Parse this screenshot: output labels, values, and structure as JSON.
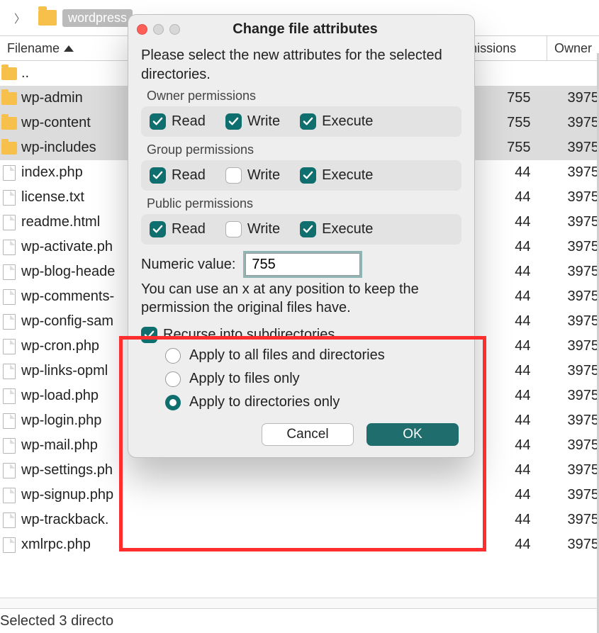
{
  "breadcrumb": {
    "folder_label": "wordpress"
  },
  "headers": {
    "filename": "Filename",
    "permissions": "rmissions",
    "owner": "Owner"
  },
  "files": [
    {
      "name": "..",
      "type": "folder",
      "sel": false,
      "perm": "",
      "own": ""
    },
    {
      "name": "wp-admin",
      "type": "folder",
      "sel": true,
      "perm": "755",
      "own": "3975"
    },
    {
      "name": "wp-content",
      "type": "folder",
      "sel": true,
      "perm": "755",
      "own": "3975"
    },
    {
      "name": "wp-includes",
      "type": "folder",
      "sel": true,
      "perm": "755",
      "own": "3975"
    },
    {
      "name": "index.php",
      "type": "file",
      "sel": false,
      "perm": "44",
      "own": "3975"
    },
    {
      "name": "license.txt",
      "type": "file",
      "sel": false,
      "perm": "44",
      "own": "3975"
    },
    {
      "name": "readme.html",
      "type": "file",
      "sel": false,
      "perm": "44",
      "own": "3975"
    },
    {
      "name": "wp-activate.ph",
      "type": "file",
      "sel": false,
      "perm": "44",
      "own": "3975"
    },
    {
      "name": "wp-blog-heade",
      "type": "file",
      "sel": false,
      "perm": "44",
      "own": "3975"
    },
    {
      "name": "wp-comments-",
      "type": "file",
      "sel": false,
      "perm": "44",
      "own": "3975"
    },
    {
      "name": "wp-config-sam",
      "type": "file",
      "sel": false,
      "perm": "44",
      "own": "3975"
    },
    {
      "name": "wp-cron.php",
      "type": "file",
      "sel": false,
      "perm": "44",
      "own": "3975"
    },
    {
      "name": "wp-links-opml",
      "type": "file",
      "sel": false,
      "perm": "44",
      "own": "3975"
    },
    {
      "name": "wp-load.php",
      "type": "file",
      "sel": false,
      "perm": "44",
      "own": "3975"
    },
    {
      "name": "wp-login.php",
      "type": "file",
      "sel": false,
      "perm": "44",
      "own": "3975"
    },
    {
      "name": "wp-mail.php",
      "type": "file",
      "sel": false,
      "perm": "44",
      "own": "3975"
    },
    {
      "name": "wp-settings.ph",
      "type": "file",
      "sel": false,
      "perm": "44",
      "own": "3975"
    },
    {
      "name": "wp-signup.php",
      "type": "file",
      "sel": false,
      "perm": "44",
      "own": "3975"
    },
    {
      "name": "wp-trackback.",
      "type": "file",
      "sel": false,
      "perm": "44",
      "own": "3975"
    },
    {
      "name": "xmlrpc.php",
      "type": "file",
      "sel": false,
      "perm": "44",
      "own": "3975"
    }
  ],
  "status_text": "Selected 3 directo",
  "dialog": {
    "title": "Change file attributes",
    "intro": "Please select the new attributes for the selected directories.",
    "groups": {
      "owner": {
        "label": "Owner permissions",
        "read": true,
        "write": true,
        "execute": true
      },
      "group": {
        "label": "Group permissions",
        "read": true,
        "write": false,
        "execute": true
      },
      "public": {
        "label": "Public permissions",
        "read": true,
        "write": false,
        "execute": true
      }
    },
    "perm_labels": {
      "read": "Read",
      "write": "Write",
      "execute": "Execute"
    },
    "numeric_label": "Numeric value:",
    "numeric_value": "755",
    "helper_text": "You can use an x at any position to keep the permission the original files have.",
    "recurse_label": "Recurse into subdirectories",
    "recurse_checked": true,
    "radios": {
      "all": {
        "label": "Apply to all files and directories",
        "selected": false
      },
      "files": {
        "label": "Apply to files only",
        "selected": false
      },
      "dirs": {
        "label": "Apply to directories only",
        "selected": true
      }
    },
    "buttons": {
      "cancel": "Cancel",
      "ok": "OK"
    }
  }
}
